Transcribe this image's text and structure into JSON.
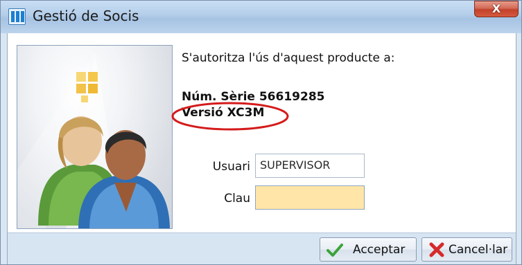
{
  "window": {
    "title": "Gestió de Socis",
    "close_label": "X"
  },
  "main": {
    "intro": "S'autoritza l'ús d'aquest producte a:",
    "serial": "Núm. Sèrie 56619285",
    "version": "Versió XC3M"
  },
  "form": {
    "user_label": "Usuari",
    "user_value": "SUPERVISOR",
    "password_label": "Clau",
    "password_value": ""
  },
  "buttons": {
    "accept_label": "Acceptar",
    "cancel_label": "Cancel·lar"
  },
  "colors": {
    "highlight_circle": "#d41b1b",
    "password_field_bg": "#ffe6a8"
  }
}
